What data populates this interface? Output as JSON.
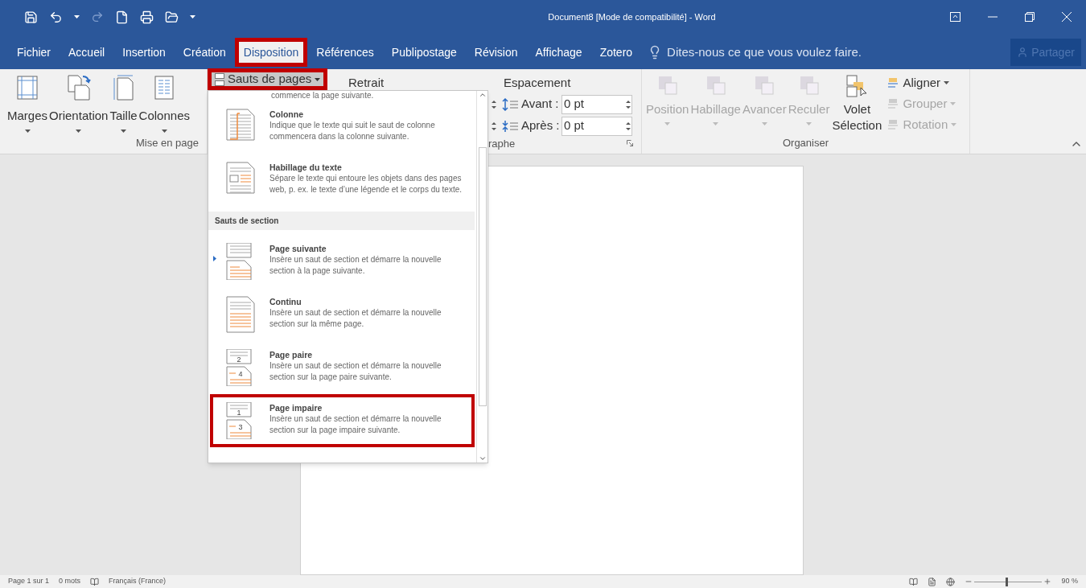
{
  "title_bar": {
    "title": "Document8 [Mode de compatibilité] - Word"
  },
  "ribbon_tabs": [
    {
      "label": "Fichier",
      "selected": false,
      "outlined": false
    },
    {
      "label": "Accueil",
      "selected": false,
      "outlined": false
    },
    {
      "label": "Insertion",
      "selected": false,
      "outlined": false
    },
    {
      "label": "Création",
      "selected": false,
      "outlined": false
    },
    {
      "label": "Disposition",
      "selected": true,
      "outlined": true
    },
    {
      "label": "Références",
      "selected": false,
      "outlined": false
    },
    {
      "label": "Publipostage",
      "selected": false,
      "outlined": false
    },
    {
      "label": "Révision",
      "selected": false,
      "outlined": false
    },
    {
      "label": "Affichage",
      "selected": false,
      "outlined": false
    },
    {
      "label": "Zotero",
      "selected": false,
      "outlined": false
    }
  ],
  "tell_me": {
    "placeholder": "Dites-nous ce que vous voulez faire."
  },
  "share_button": {
    "label": "Partager",
    "disabled": true
  },
  "page_setup": {
    "label": "Mise en page",
    "buttons": [
      {
        "label": "Marges",
        "kind": "margins"
      },
      {
        "label": "Orientation",
        "kind": "orientation"
      },
      {
        "label": "Taille",
        "kind": "size"
      },
      {
        "label": "Colonnes",
        "kind": "columns"
      }
    ]
  },
  "breaks_button": {
    "label": "Sauts de pages",
    "outlined": true
  },
  "paragraph": {
    "label": "raphe",
    "indent_heading": "Retrait",
    "spacing_heading": "Espacement",
    "spacing_before": {
      "label": "Avant :",
      "value": "0 pt"
    },
    "spacing_after": {
      "label": "Après :",
      "value": "0 pt"
    }
  },
  "arrange": {
    "label": "Organiser",
    "buttons": [
      {
        "label": "Position",
        "disabled": true
      },
      {
        "label": "Habillage",
        "disabled": true
      },
      {
        "label": "Avancer",
        "disabled": true
      },
      {
        "label": "Reculer",
        "disabled": true
      },
      {
        "label": "Volet Sélection",
        "disabled": false
      }
    ],
    "small_buttons": [
      {
        "label": "Aligner",
        "disabled": false
      },
      {
        "label": "Grouper",
        "disabled": true
      },
      {
        "label": "Rotation",
        "disabled": true
      }
    ]
  },
  "breaks_menu": {
    "cut_text": "commence la page suivante.",
    "entries": [
      {
        "kind": "column",
        "title": "Colonne",
        "description": "Indique que le texte qui suit le saut de colonne commencera dans la colonne suivante.",
        "selected": false,
        "outlined": false
      },
      {
        "kind": "text_wrap",
        "title": "Habillage du texte",
        "description": "Sépare le texte qui entoure les objets dans des pages web, p. ex. le texte d’une légende et le corps du texte.",
        "selected": false,
        "outlined": false
      },
      {
        "kind": "heading",
        "title": "Sauts de section"
      },
      {
        "kind": "next_page",
        "title": "Page suivante",
        "description": "Insère un saut de section et démarre la nouvelle section à la page suivante.",
        "selected": true,
        "outlined": false
      },
      {
        "kind": "continuous",
        "title": "Continu",
        "description": "Insère un saut de section et démarre la nouvelle section sur la même page.",
        "selected": false,
        "outlined": false
      },
      {
        "kind": "even_page",
        "title": "Page paire",
        "description": "Insère un saut de section et démarre la nouvelle section sur la page paire suivante.",
        "icon_labels": [
          "2",
          "4"
        ],
        "selected": false,
        "outlined": false
      },
      {
        "kind": "odd_page",
        "title": "Page impaire",
        "description": "Insère un saut de section et démarre la nouvelle section sur la page impaire suivante.",
        "icon_labels": [
          "1",
          "3"
        ],
        "selected": false,
        "outlined": true
      }
    ]
  },
  "status_bar": {
    "page": "Page 1 sur 1",
    "words": "0 mots",
    "language": "Français (France)",
    "zoom": {
      "level": 0.46,
      "reading": "90 %"
    }
  }
}
